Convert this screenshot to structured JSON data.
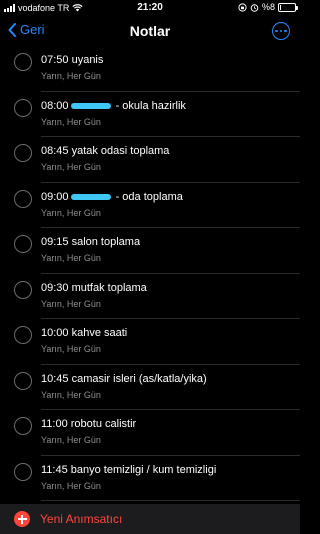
{
  "status_bar": {
    "carrier": "vodafone TR",
    "time": "21:20",
    "battery": "%8",
    "battery_level": 0.08
  },
  "nav": {
    "back_label": "Geri",
    "title": "Notlar",
    "more_icon": "ellipsis-circle-icon"
  },
  "reminders": [
    {
      "title": "07:50 uyanis",
      "subtitle": "Yarın, Her Gün",
      "redacted": false
    },
    {
      "title_before": "08:00",
      "title_after": " - okula hazirlik",
      "subtitle": "Yarın, Her Gün",
      "redacted": true
    },
    {
      "title": "08:45 yatak odasi toplama",
      "subtitle": "Yarın, Her Gün",
      "redacted": false
    },
    {
      "title_before": "09:00",
      "title_after": " - oda toplama",
      "subtitle": "Yarın, Her Gün",
      "redacted": true
    },
    {
      "title": "09:15 salon toplama",
      "subtitle": "Yarın, Her Gün",
      "redacted": false
    },
    {
      "title": "09:30 mutfak toplama",
      "subtitle": "Yarın, Her Gün",
      "redacted": false
    },
    {
      "title": "10:00 kahve saati",
      "subtitle": "Yarın, Her Gün",
      "redacted": false
    },
    {
      "title": "10:45 camasir isleri (as/katla/yika)",
      "subtitle": "Yarın, Her Gün",
      "redacted": false
    },
    {
      "title": "11:00 robotu calistir",
      "subtitle": "Yarın, Her Gün",
      "redacted": false
    },
    {
      "title": "11:45 banyo temizligi / kum temizligi",
      "subtitle": "Yarın, Her Gün",
      "redacted": false
    }
  ],
  "bottom": {
    "add_label": "Yeni Anımsatıcı",
    "accent_color": "#ff453a"
  },
  "colors": {
    "background": "#000000",
    "tint": "#1f8bff",
    "secondary_text": "#8e8e93"
  }
}
